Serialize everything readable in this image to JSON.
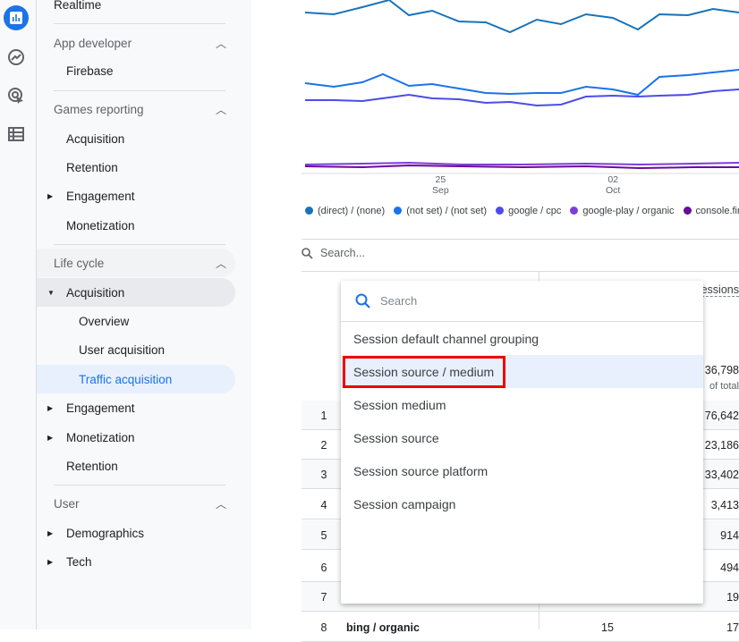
{
  "rail": {
    "icons": [
      "reports-icon",
      "explore-icon",
      "advertising-icon",
      "configure-icon"
    ]
  },
  "sidebar": {
    "realtime": "Realtime",
    "app_developer": {
      "label": "App developer",
      "items": [
        "Firebase"
      ]
    },
    "games_reporting": {
      "label": "Games reporting",
      "items": [
        "Acquisition",
        "Retention",
        "Engagement",
        "Monetization"
      ]
    },
    "life_cycle": {
      "label": "Life cycle",
      "acquisition": "Acquisition",
      "sub": [
        "Overview",
        "User acquisition",
        "Traffic acquisition"
      ],
      "items": [
        "Engagement",
        "Monetization",
        "Retention"
      ]
    },
    "user": {
      "label": "User",
      "items": [
        "Demographics",
        "Tech"
      ]
    }
  },
  "chart": {
    "x_ticks": [
      {
        "day": "25",
        "month": "Sep"
      },
      {
        "day": "02",
        "month": "Oct"
      }
    ],
    "legend": [
      {
        "label": "(direct) / (none)",
        "color": "#1a73b8"
      },
      {
        "label": "(not set) / (not set)",
        "color": "#1a73e8"
      },
      {
        "label": "google / cpc",
        "color": "#4c4ce8"
      },
      {
        "label": "google-play / organic",
        "color": "#7c3fd6"
      },
      {
        "label": "console.fire",
        "color": "#6a0a9a"
      }
    ]
  },
  "table": {
    "search_placeholder": "Search...",
    "metric_header": "essions",
    "total": "36,798",
    "total_note": "of total",
    "rows": [
      {
        "n": "1",
        "v": "76,642"
      },
      {
        "n": "2",
        "v": "23,186"
      },
      {
        "n": "3",
        "v": "33,402"
      },
      {
        "n": "4",
        "v": "3,413"
      },
      {
        "n": "5",
        "v": "914"
      },
      {
        "n": "6",
        "v": "494"
      },
      {
        "n": "7",
        "v": "19"
      },
      {
        "n": "8",
        "d": "bing / organic",
        "m": "15",
        "v": "17"
      }
    ]
  },
  "dropdown": {
    "search_placeholder": "Search",
    "items": [
      "Session default channel grouping",
      "Session source / medium",
      "Session medium",
      "Session source",
      "Session source platform",
      "Session campaign"
    ],
    "highlighted": "Session source / medium"
  }
}
